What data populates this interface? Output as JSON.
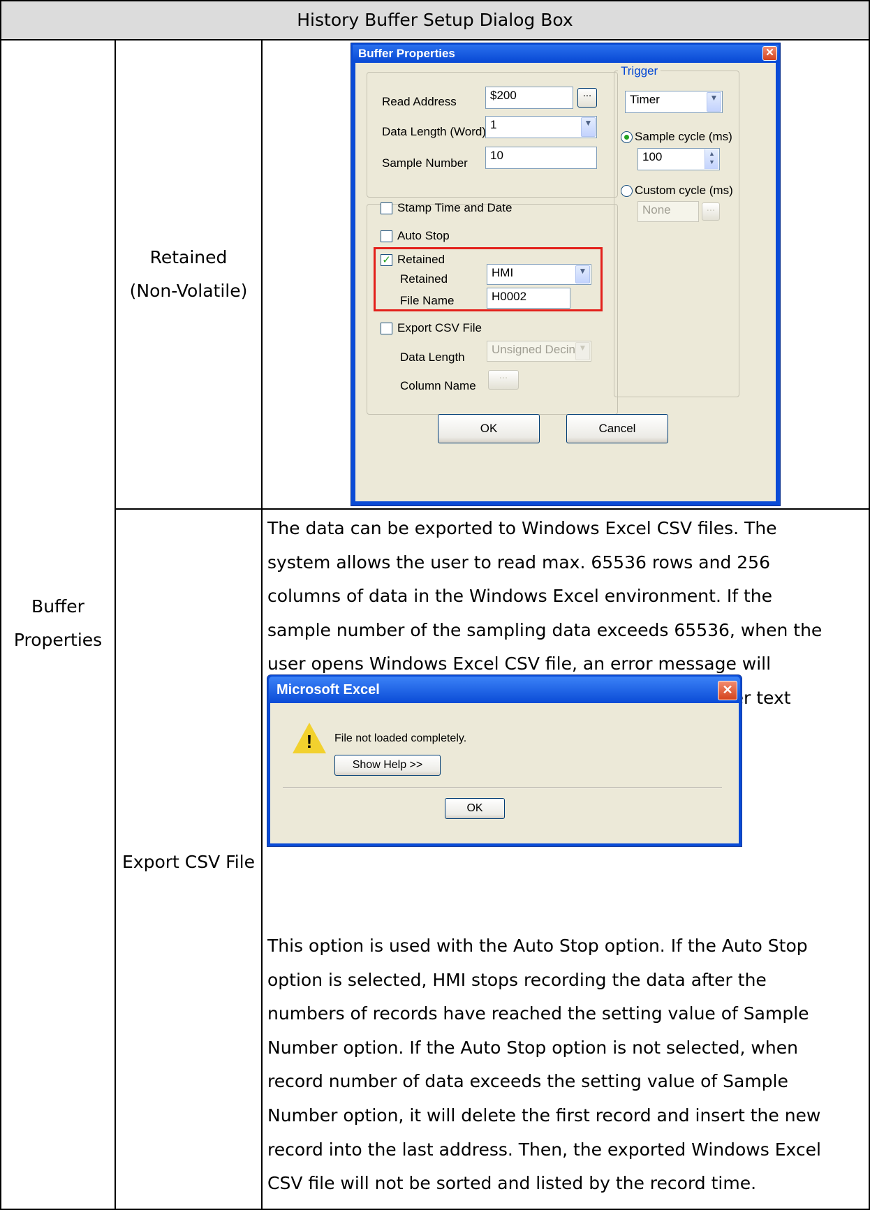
{
  "table": {
    "header": "History Buffer Setup Dialog Box",
    "group_label": "Buffer\nProperties",
    "rows": [
      {
        "label": "Retained\n(Non-Volatile)"
      },
      {
        "label": "Export CSV File",
        "paragraph_1": "The data can be exported to Windows Excel CSV files. The\nsystem allows the user to read max. 65536 rows and 256\ncolumns of data in the Windows Excel environment. If the\nsample number of the sampling data exceeds 65536, when the\nuser opens Windows Excel CSV file, an error message will\ndisplay. At this time, the user can use Notepad or other text\nediting tool to open the CSV file.",
        "paragraph_2": "This option is used with the Auto Stop option. If the Auto Stop\noption is selected, HMI stops recording the data after the\nnumbers of records have reached the setting value of Sample\nNumber option. If the Auto Stop option is not selected, when\nrecord number of data exceeds the setting value of Sample\nNumber option, it will delete the first record and insert the new\nrecord into the last address. Then, the exported Windows Excel\nCSV file will not be sorted and listed by the record time."
      }
    ]
  },
  "buffer_dialog": {
    "title": "Buffer Properties",
    "read_address_label": "Read Address",
    "read_address_value": "$200",
    "browse_glyph": "...",
    "data_length_label": "Data Length (Word)",
    "data_length_value": "1",
    "sample_number_label": "Sample Number",
    "sample_number_value": "10",
    "stamp_label": "Stamp Time and Date",
    "auto_stop_label": "Auto Stop",
    "retained_check_label": "Retained",
    "retained_label": "Retained",
    "retained_value": "HMI",
    "file_name_label": "File Name",
    "file_name_value": "H0002",
    "export_csv_label": "Export CSV File",
    "csv_data_length_label": "Data Length",
    "csv_data_length_value": "Unsigned Decin",
    "column_name_label": "Column Name",
    "trigger_label": "Trigger",
    "trigger_value": "Timer",
    "sample_cycle_label": "Sample cycle (ms)",
    "sample_cycle_value": "100",
    "custom_cycle_label": "Custom cycle (ms)",
    "custom_cycle_value": "None",
    "ok_label": "OK",
    "cancel_label": "Cancel",
    "checked": {
      "stamp": false,
      "auto_stop": false,
      "retained": true,
      "export_csv": false
    },
    "radio_selected": "sample_cycle"
  },
  "excel_dialog": {
    "title": "Microsoft Excel",
    "message": "File not loaded completely.",
    "help_label": "Show Help >>",
    "ok_label": "OK"
  },
  "colors": {
    "highlight_box": "#e3201b",
    "title_bar": "#0a4bd6",
    "dialog_face": "#ece9d8"
  },
  "icons": [
    "close-icon",
    "warning-icon",
    "check-icon",
    "dropdown-arrow-icon",
    "spin-arrows-icon"
  ]
}
